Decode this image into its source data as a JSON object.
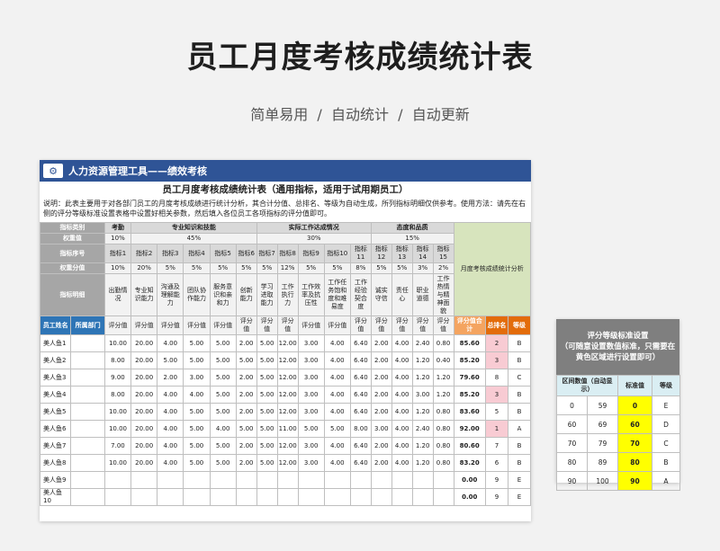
{
  "hero": {
    "title": "员工月度考核成绩统计表",
    "subtitle": "简单易用  /  自动统计  /  自动更新"
  },
  "toolbar": {
    "title": "人力资源管理工具——绩效考核",
    "icon": "wrench-icon"
  },
  "sheet": {
    "title": "员工月度考核成绩统计表（通用指标，适用于试用期员工）",
    "note": "说明：此表主要用于对各部门员工的月度考核成绩进行统计分析，其合计分值、总排名、等级为自动生成，所列指标明细仅供参考。使用方法：请先在右侧的评分等级标准设置表格中设置好相关参数，然后填入各位员工各项指标的评分值即可。"
  },
  "header": {
    "cat_label": "指标类别",
    "weight_label": "权重值",
    "idx_label": "指标序号",
    "wscore_label": "权重分值",
    "detail_label": "指标明细",
    "cats": [
      {
        "name": "考勤",
        "weight": "10%"
      },
      {
        "name": "专业知识和技能",
        "weight": "45%"
      },
      {
        "name": "实际工作达成情况",
        "weight": "30%"
      },
      {
        "name": "态度和品质",
        "weight": "15%"
      }
    ],
    "analysis": "月度考核成绩统计分析",
    "indices": [
      "指标1",
      "指标2",
      "指标3",
      "指标4",
      "指标5",
      "指标6",
      "指标7",
      "指标8",
      "指标9",
      "指标10",
      "指标11",
      "指标12",
      "指标13",
      "指标14",
      "指标15"
    ],
    "wscores": [
      "10%",
      "20%",
      "5%",
      "5%",
      "5%",
      "5%",
      "5%",
      "12%",
      "5%",
      "5%",
      "8%",
      "5%",
      "5%",
      "3%",
      "2%"
    ],
    "details": [
      "出勤情况",
      "专业知识能力",
      "沟通及理解能力",
      "团队协作能力",
      "服务意识和亲和力",
      "创新能力",
      "学习进取能力",
      "工作执行力",
      "工作效率及抗压性",
      "工作任务饱和度和难易度",
      "工作经验契合度",
      "诚实守信",
      "责任心",
      "职业道德",
      "工作热情与精神面貌"
    ],
    "name_col": "员工姓名",
    "dept_col": "所属部门",
    "score_label": "评分值",
    "total_col": "评分值合计",
    "rank_col": "总排名",
    "grade_col": "等级"
  },
  "rows": [
    {
      "name": "美人鱼1",
      "dept": "",
      "scores": [
        "10.00",
        "20.00",
        "4.00",
        "5.00",
        "5.00",
        "2.00",
        "5.00",
        "12.00",
        "3.00",
        "4.00",
        "6.40",
        "2.00",
        "4.00",
        "2.40",
        "0.80"
      ],
      "total": "85.60",
      "rank": "2",
      "grade": "B",
      "hl": true
    },
    {
      "name": "美人鱼2",
      "dept": "",
      "scores": [
        "8.00",
        "20.00",
        "5.00",
        "5.00",
        "5.00",
        "5.00",
        "5.00",
        "12.00",
        "3.00",
        "4.00",
        "6.40",
        "2.00",
        "4.00",
        "1.20",
        "0.40"
      ],
      "total": "85.20",
      "rank": "3",
      "grade": "B",
      "hl": true
    },
    {
      "name": "美人鱼3",
      "dept": "",
      "scores": [
        "9.00",
        "20.00",
        "2.00",
        "3.00",
        "5.00",
        "2.00",
        "5.00",
        "12.00",
        "3.00",
        "4.00",
        "6.40",
        "2.00",
        "4.00",
        "1.20",
        "1.20"
      ],
      "total": "79.60",
      "rank": "8",
      "grade": "C",
      "hl": false
    },
    {
      "name": "美人鱼4",
      "dept": "",
      "scores": [
        "8.00",
        "20.00",
        "4.00",
        "4.00",
        "5.00",
        "2.00",
        "5.00",
        "12.00",
        "3.00",
        "4.00",
        "6.40",
        "2.00",
        "4.00",
        "3.00",
        "1.20"
      ],
      "total": "85.20",
      "rank": "3",
      "grade": "B",
      "hl": true
    },
    {
      "name": "美人鱼5",
      "dept": "",
      "scores": [
        "10.00",
        "20.00",
        "4.00",
        "5.00",
        "5.00",
        "2.00",
        "5.00",
        "12.00",
        "3.00",
        "4.00",
        "6.40",
        "2.00",
        "4.00",
        "1.20",
        "0.80"
      ],
      "total": "83.60",
      "rank": "5",
      "grade": "B",
      "hl": false
    },
    {
      "name": "美人鱼6",
      "dept": "",
      "scores": [
        "10.00",
        "20.00",
        "4.00",
        "5.00",
        "4.00",
        "5.00",
        "5.00",
        "11.00",
        "5.00",
        "5.00",
        "8.00",
        "3.00",
        "4.00",
        "2.40",
        "0.80"
      ],
      "total": "92.00",
      "rank": "1",
      "grade": "A",
      "hl": true
    },
    {
      "name": "美人鱼7",
      "dept": "",
      "scores": [
        "7.00",
        "20.00",
        "4.00",
        "5.00",
        "5.00",
        "2.00",
        "5.00",
        "12.00",
        "3.00",
        "4.00",
        "6.40",
        "2.00",
        "4.00",
        "1.20",
        "0.80"
      ],
      "total": "80.60",
      "rank": "7",
      "grade": "B",
      "hl": false
    },
    {
      "name": "美人鱼8",
      "dept": "",
      "scores": [
        "10.00",
        "20.00",
        "4.00",
        "5.00",
        "5.00",
        "2.00",
        "5.00",
        "12.00",
        "3.00",
        "4.00",
        "6.40",
        "2.00",
        "4.00",
        "1.20",
        "0.80"
      ],
      "total": "83.20",
      "rank": "6",
      "grade": "B",
      "hl": false
    },
    {
      "name": "美人鱼9",
      "dept": "",
      "scores": [
        "",
        "",
        "",
        "",
        "",
        "",
        "",
        "",
        "",
        "",
        "",
        "",
        "",
        "",
        ""
      ],
      "total": "0.00",
      "rank": "9",
      "grade": "E",
      "hl": false
    },
    {
      "name": "美人鱼10",
      "dept": "",
      "scores": [
        "",
        "",
        "",
        "",
        "",
        "",
        "",
        "",
        "",
        "",
        "",
        "",
        "",
        "",
        ""
      ],
      "total": "0.00",
      "rank": "9",
      "grade": "E",
      "hl": false
    }
  ],
  "grade_panel": {
    "title": "评分等级标准设置",
    "subtitle": "（可随意设置数值标准，只需要在黄色区域进行设置即可）",
    "cols": {
      "range": "区间数值（自动显示）",
      "std": "标准值",
      "grade": "等级"
    },
    "rows": [
      {
        "lo": "0",
        "hi": "59",
        "std": "0",
        "grade": "E"
      },
      {
        "lo": "60",
        "hi": "69",
        "std": "60",
        "grade": "D"
      },
      {
        "lo": "70",
        "hi": "79",
        "std": "70",
        "grade": "C"
      },
      {
        "lo": "80",
        "hi": "89",
        "std": "80",
        "grade": "B"
      },
      {
        "lo": "90",
        "hi": "100",
        "std": "90",
        "grade": "A"
      }
    ]
  }
}
